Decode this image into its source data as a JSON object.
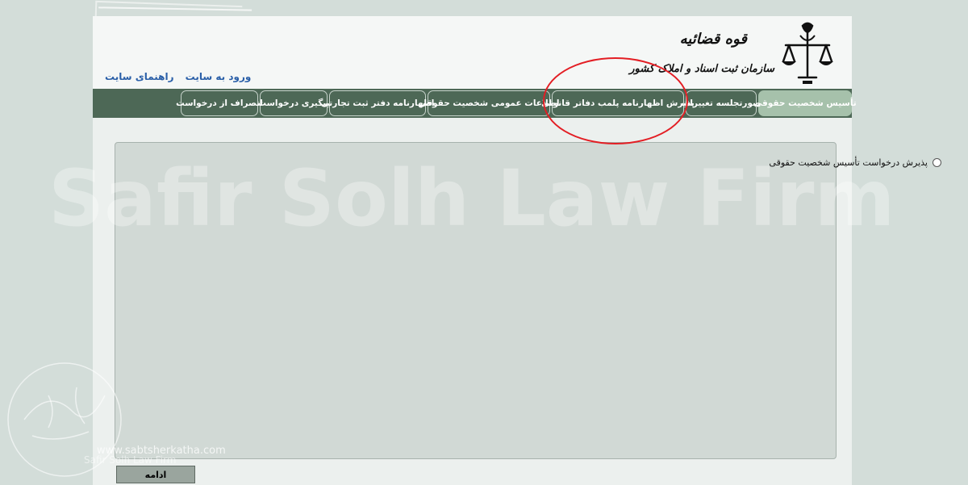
{
  "header": {
    "judiciary_title": "قوه قضائیه",
    "agency_title": "سازمان ثبت اسناد و املاک کشور",
    "emblem_icon": "scales-of-justice-icon"
  },
  "top_links": {
    "login": "ورود به سایت",
    "guide": "راهنمای سایت",
    "color": "#2a5fa8"
  },
  "nav": {
    "background": "#4d6856",
    "active_color": "#a6c1ab",
    "tabs": [
      {
        "label": "تأسیس شخصیت حقوقی",
        "active": true
      },
      {
        "label": "صورتجلسه تغییرات",
        "active": false
      },
      {
        "label": "پذیرش اظهارنامه پلمب دفاتر قانونی",
        "active": false
      },
      {
        "label": "اطلاعات عمومی شخصیت حقوقی",
        "active": false
      },
      {
        "label": "اظهارنامه دفتر ثبت تجارتی",
        "active": false
      },
      {
        "label": "پیگیری درخواست",
        "active": false
      },
      {
        "label": "انصراف از درخواست",
        "active": false
      }
    ]
  },
  "main": {
    "option_label": "پذیرش درخواست تأسیس شخصیت حقوقی",
    "option_selected": false,
    "continue_label": "ادامه"
  },
  "overlay": {
    "watermark": "Safir Solh Law Firm",
    "corner_url": "www.sabtsherkatha.com",
    "corner_firm": "Safir Solh Law Firm",
    "highlight_color": "#e31e24"
  }
}
